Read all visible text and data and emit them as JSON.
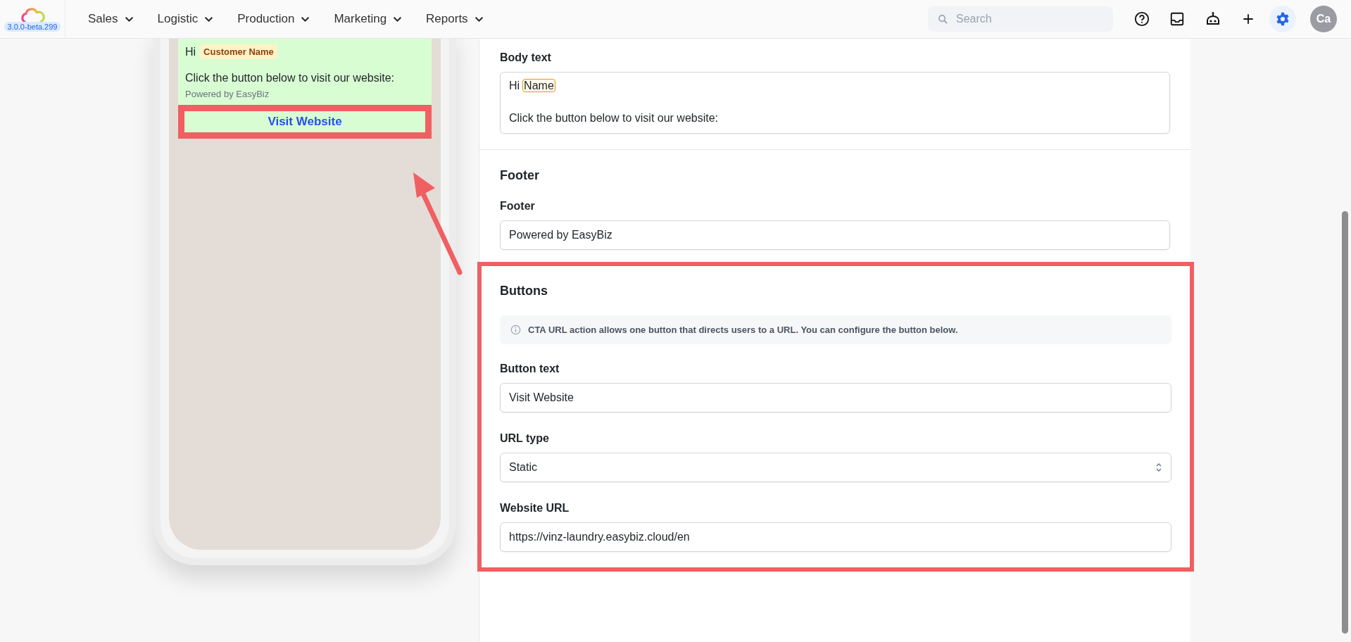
{
  "header": {
    "version": "3.0.0-beta.299",
    "nav": [
      {
        "label": "Sales"
      },
      {
        "label": "Logistic"
      },
      {
        "label": "Production"
      },
      {
        "label": "Marketing"
      },
      {
        "label": "Reports"
      }
    ],
    "search": {
      "placeholder": "Search"
    },
    "avatar": "Ca"
  },
  "preview": {
    "greeting": "Hi",
    "variable": "Customer Name",
    "body": "Click the button below to visit our website:",
    "footer": "Powered by EasyBiz",
    "button": "Visit Website"
  },
  "form": {
    "body_text": {
      "label": "Body text",
      "greeting": "Hi",
      "variable": "Name",
      "body": "Click the button below to visit our website:"
    },
    "footer_section": {
      "heading": "Footer",
      "label": "Footer",
      "value": "Powered by EasyBiz"
    },
    "buttons_section": {
      "heading": "Buttons",
      "info": "CTA URL action allows one button that directs users to a URL. You can configure the button below.",
      "fields": [
        {
          "kind": "text",
          "label": "Button text",
          "value": "Visit Website"
        },
        {
          "kind": "select",
          "label": "URL type",
          "value": "Static"
        },
        {
          "kind": "text",
          "label": "Website URL",
          "value": "https://vinz-laundry.easybiz.cloud/en"
        }
      ]
    }
  }
}
